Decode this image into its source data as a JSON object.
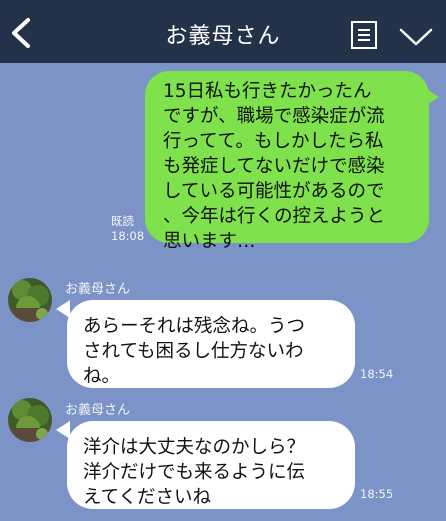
{
  "header": {
    "title": "お義母さん",
    "back_icon": "chevron-left-icon",
    "menu_icon": "note-icon",
    "expand_icon": "chevron-down-icon",
    "background": "#243249"
  },
  "chat": {
    "background": "#7b93c6",
    "messages": [
      {
        "direction": "outgoing",
        "lines": [
          "15日私も行きたかったん",
          "ですが、職場で感染症が流",
          "行ってて。もしかしたら私",
          "も発症してないだけで感染",
          "している可能性があるので",
          "、今年は行くの控えようと",
          "思います…"
        ],
        "read_label": "既読",
        "time": "18:08"
      },
      {
        "direction": "incoming",
        "sender": "お義母さん",
        "lines": [
          "あらーそれは残念ね。うつ",
          "されても困るし仕方ないわ",
          "ね。"
        ],
        "time": "18:54"
      },
      {
        "direction": "incoming",
        "sender": "お義母さん",
        "lines": [
          "洋介は大丈夫なのかしら？",
          "洋介だけでも来るように伝",
          "えてくださいね"
        ],
        "time": "18:55"
      }
    ]
  },
  "colors": {
    "outgoing_bubble": "#7fe14b",
    "incoming_bubble": "#ffffff"
  }
}
